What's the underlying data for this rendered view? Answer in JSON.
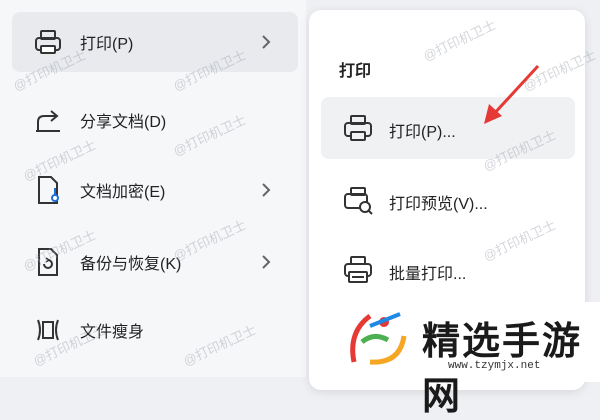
{
  "left_menu": {
    "items": [
      {
        "label": "打印(P)",
        "icon": "printer-icon",
        "has_submenu": true,
        "active": true
      },
      {
        "label": "分享文档(D)",
        "icon": "share-icon",
        "has_submenu": false
      },
      {
        "label": "文档加密(E)",
        "icon": "lock-document-icon",
        "has_submenu": true
      },
      {
        "label": "备份与恢复(K)",
        "icon": "backup-restore-icon",
        "has_submenu": true
      },
      {
        "label": "文件瘦身",
        "icon": "compress-file-icon",
        "has_submenu": false
      }
    ]
  },
  "submenu": {
    "title": "打印",
    "items": [
      {
        "label": "打印(P)...",
        "icon": "printer-icon",
        "active": true
      },
      {
        "label": "打印预览(V)...",
        "icon": "print-preview-icon"
      },
      {
        "label": "批量打印...",
        "icon": "batch-print-icon"
      }
    ]
  },
  "annotation": {
    "color": "#e53935"
  },
  "watermark": {
    "text": "@打印机卫士"
  },
  "logo": {
    "name": "精选手游网",
    "url": "www.tzymjx.net"
  }
}
